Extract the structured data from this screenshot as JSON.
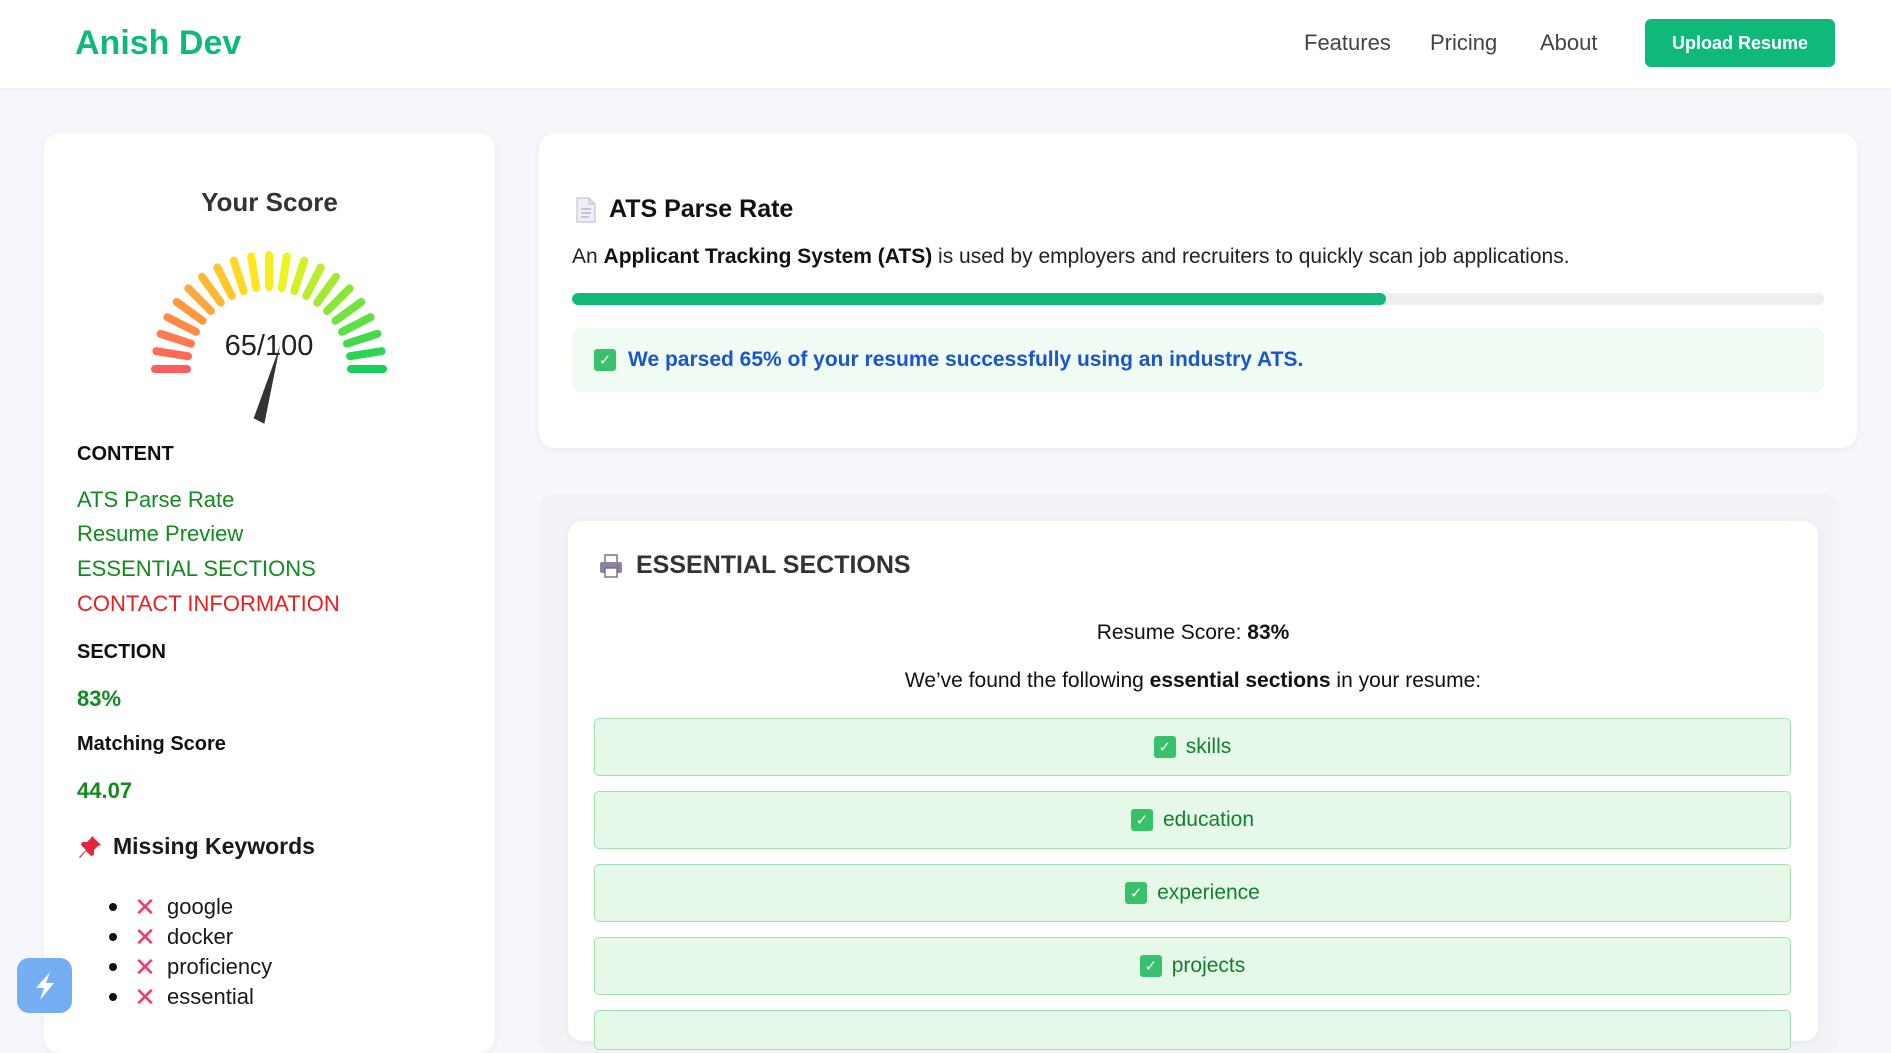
{
  "header": {
    "brand": "Anish Dev",
    "nav": {
      "features": "Features",
      "pricing": "Pricing",
      "about": "About"
    },
    "upload_label": "Upload Resume"
  },
  "sidebar": {
    "score_title": "Your Score",
    "gauge": {
      "value": 65,
      "max": 100,
      "label": "65/100"
    },
    "content_heading": "CONTENT",
    "links": [
      "ATS Parse Rate",
      "Resume Preview",
      "ESSENTIAL SECTIONS",
      "CONTACT INFORMATION"
    ],
    "section_heading": "SECTION",
    "section_value": "83%",
    "matching_heading": "Matching Score",
    "matching_value": "44.07",
    "missing_heading": "Missing Keywords",
    "missing_keywords": [
      "google",
      "docker",
      "proficiency",
      "essential"
    ]
  },
  "ats": {
    "title": "ATS Parse Rate",
    "desc_prefix": "An ",
    "desc_bold": "Applicant Tracking System (ATS)",
    "desc_suffix": " is used by employers and recruiters to quickly scan job applications.",
    "progress_percent": 65,
    "note": "We parsed 65% of your resume successfully using an industry ATS."
  },
  "essential": {
    "title": "ESSENTIAL SECTIONS",
    "score_prefix": "Resume Score: ",
    "score_value": "83%",
    "found_prefix": "We’ve found the following ",
    "found_bold": "essential sections",
    "found_suffix": " in your resume:",
    "items": [
      "skills",
      "education",
      "experience",
      "projects"
    ]
  },
  "colors": {
    "brand": "#10b97a",
    "link_green": "#128a20",
    "link_red": "#e81f1f",
    "note_blue": "#1956c9"
  },
  "icons": {
    "ats": "document-icon",
    "essential": "printer-icon",
    "missing": "pushpin-icon",
    "missing_item": "cross-mark-icon",
    "found_item": "checkbox-icon"
  }
}
